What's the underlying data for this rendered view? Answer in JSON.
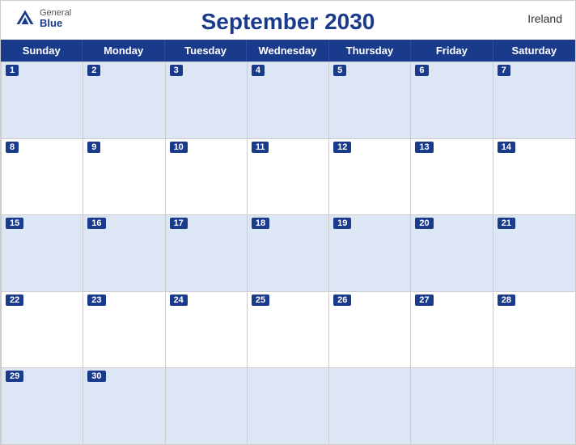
{
  "header": {
    "title": "September 2030",
    "country": "Ireland",
    "logo": {
      "general": "General",
      "blue": "Blue"
    }
  },
  "days": [
    "Sunday",
    "Monday",
    "Tuesday",
    "Wednesday",
    "Thursday",
    "Friday",
    "Saturday"
  ],
  "weeks": [
    {
      "shaded": true,
      "cells": [
        {
          "num": "1",
          "empty": false
        },
        {
          "num": "2",
          "empty": false
        },
        {
          "num": "3",
          "empty": false
        },
        {
          "num": "4",
          "empty": false
        },
        {
          "num": "5",
          "empty": false
        },
        {
          "num": "6",
          "empty": false
        },
        {
          "num": "7",
          "empty": false
        }
      ]
    },
    {
      "shaded": false,
      "cells": [
        {
          "num": "8",
          "empty": false
        },
        {
          "num": "9",
          "empty": false
        },
        {
          "num": "10",
          "empty": false
        },
        {
          "num": "11",
          "empty": false
        },
        {
          "num": "12",
          "empty": false
        },
        {
          "num": "13",
          "empty": false
        },
        {
          "num": "14",
          "empty": false
        }
      ]
    },
    {
      "shaded": true,
      "cells": [
        {
          "num": "15",
          "empty": false
        },
        {
          "num": "16",
          "empty": false
        },
        {
          "num": "17",
          "empty": false
        },
        {
          "num": "18",
          "empty": false
        },
        {
          "num": "19",
          "empty": false
        },
        {
          "num": "20",
          "empty": false
        },
        {
          "num": "21",
          "empty": false
        }
      ]
    },
    {
      "shaded": false,
      "cells": [
        {
          "num": "22",
          "empty": false
        },
        {
          "num": "23",
          "empty": false
        },
        {
          "num": "24",
          "empty": false
        },
        {
          "num": "25",
          "empty": false
        },
        {
          "num": "26",
          "empty": false
        },
        {
          "num": "27",
          "empty": false
        },
        {
          "num": "28",
          "empty": false
        }
      ]
    },
    {
      "shaded": true,
      "cells": [
        {
          "num": "29",
          "empty": false
        },
        {
          "num": "30",
          "empty": false
        },
        {
          "num": "",
          "empty": true
        },
        {
          "num": "",
          "empty": true
        },
        {
          "num": "",
          "empty": true
        },
        {
          "num": "",
          "empty": true
        },
        {
          "num": "",
          "empty": true
        }
      ]
    }
  ]
}
